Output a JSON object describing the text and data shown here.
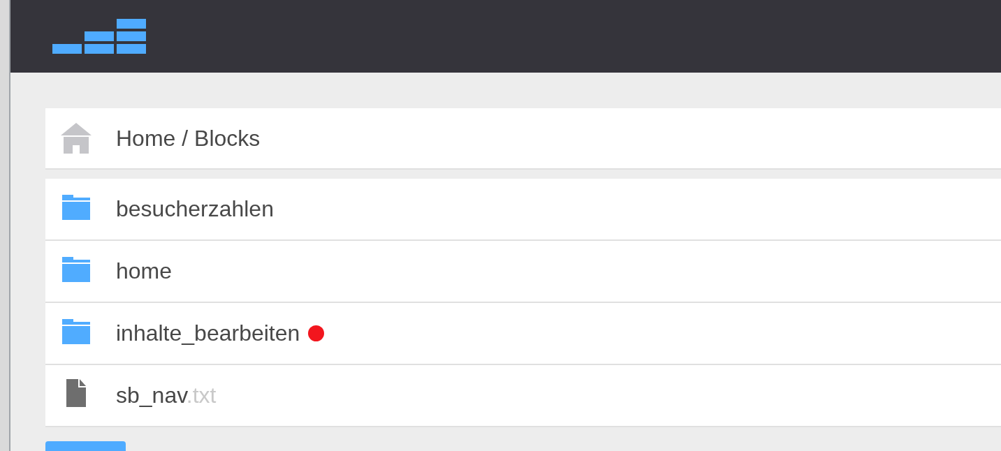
{
  "breadcrumb": {
    "text": "Home / Blocks"
  },
  "items": [
    {
      "kind": "folder",
      "name": "besucherzahlen"
    },
    {
      "kind": "folder",
      "name": "home"
    },
    {
      "kind": "folder",
      "name": "inhalte_bearbeiten",
      "color": "#f2161e"
    },
    {
      "kind": "file",
      "name": "sb_nav",
      "extension": ".txt"
    }
  ]
}
